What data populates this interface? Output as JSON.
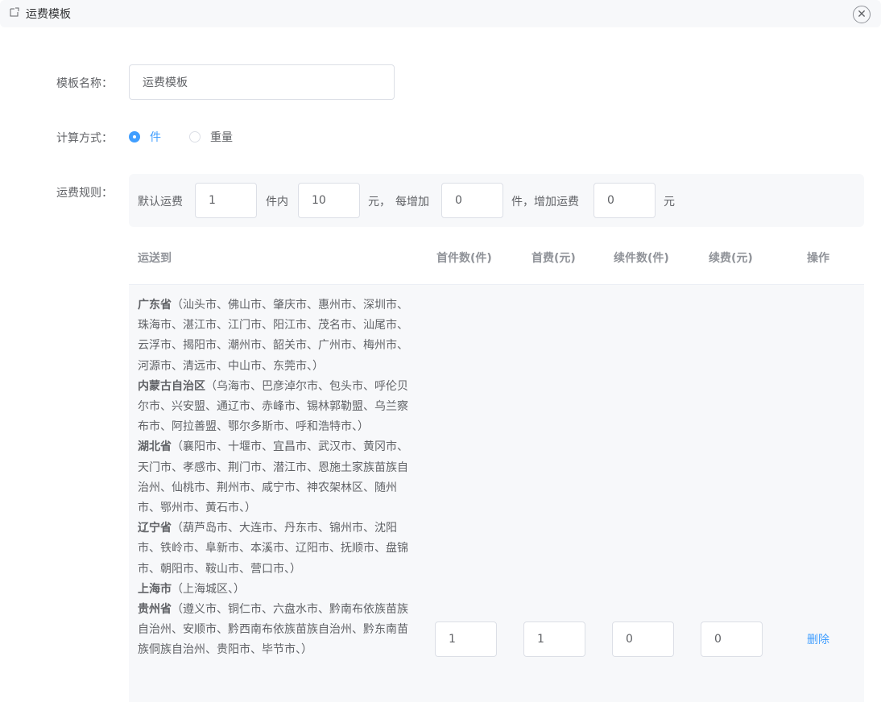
{
  "header": {
    "title": "运费模板"
  },
  "form": {
    "name_label": "模板名称：",
    "name_value": "运费模板",
    "calc_label": "计算方式：",
    "calc_options": [
      {
        "label": "件",
        "checked": true
      },
      {
        "label": "重量",
        "checked": false
      }
    ],
    "rule_label": "运费规则："
  },
  "rule": {
    "t1": "默认运费",
    "v1": "1",
    "t2": "件内",
    "v2": "10",
    "t3": "元，",
    "t4": "每增加",
    "v3": "0",
    "t5": "件，增加运费",
    "v4": "0",
    "t6": "元"
  },
  "table": {
    "headers": [
      "运送到",
      "首件数(件)",
      "首费(元)",
      "续件数(件)",
      "续费(元)",
      "操作"
    ],
    "row": {
      "regions": [
        {
          "province": "广东省",
          "cities": "（汕头市、佛山市、肇庆市、惠州市、深圳市、珠海市、湛江市、江门市、阳江市、茂名市、汕尾市、云浮市、揭阳市、潮州市、韶关市、广州市、梅州市、河源市、清远市、中山市、东莞市、）"
        },
        {
          "province": "内蒙古自治区",
          "cities": "（乌海市、巴彦淖尔市、包头市、呼伦贝尔市、兴安盟、通辽市、赤峰市、锡林郭勒盟、乌兰察布市、阿拉善盟、鄂尔多斯市、呼和浩特市、）"
        },
        {
          "province": "湖北省",
          "cities": "（襄阳市、十堰市、宜昌市、武汉市、黄冈市、天门市、孝感市、荆门市、潜江市、恩施土家族苗族自治州、仙桃市、荆州市、咸宁市、神农架林区、随州市、鄂州市、黄石市、）"
        },
        {
          "province": "辽宁省",
          "cities": "（葫芦岛市、大连市、丹东市、锦州市、沈阳市、铁岭市、阜新市、本溪市、辽阳市、抚顺市、盘锦市、朝阳市、鞍山市、营口市、）"
        },
        {
          "province": "上海市",
          "cities": "（上海城区、）"
        },
        {
          "province": "贵州省",
          "cities": "（遵义市、铜仁市、六盘水市、黔南布依族苗族自治州、安顺市、黔西南布依族苗族自治州、黔东南苗族侗族自治州、贵阳市、毕节市、）"
        }
      ],
      "first_count": "1",
      "first_fee": "1",
      "next_count": "0",
      "next_fee": "0",
      "action": "删除"
    }
  },
  "colors": {
    "accent": "#409eff",
    "panel": "#f7f8fa",
    "border": "#dcdfe6"
  }
}
